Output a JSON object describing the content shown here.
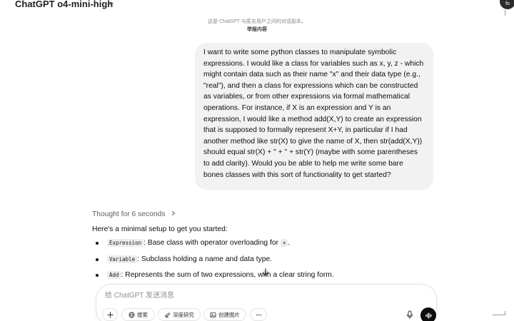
{
  "header": {
    "model_title": "ChatGPT o4-mini-high",
    "avatar_label": "fo"
  },
  "shared_note": {
    "line1": "这是 ChatGPT 与匿名用户之间的对话副本。",
    "line2": "举报内容"
  },
  "conversation": {
    "user_message": "I want to write some python classes to manipulate symbolic expressions.  I would like a class for variables such as x, y, z - which might contain data such as their name \"x\" and their data type (e.g., \"real\"), and then a class for expressions which can be constructed as variables, or from other expressions via formal mathematical operations.  For instance, if X is an expression and Y is an expression, I would like a method add(X,Y) to create an expression that is supposed to formally represent X+Y, in particular if I had another method like str(X) to give the name of X, then str(add(X,Y)) should equal str(X) + \" + \" + str(Y) (maybe with some parentheses to add clarity).  Would you be able to help me write some bare bones classes with this sort of functionality to get started?",
    "thought_label": "Thought for 6 seconds",
    "assistant_intro": "Here's a minimal setup to get you started:",
    "bullets": [
      {
        "code": "Expression",
        "text": ": Base class with operator overloading for ",
        "code2": "+",
        "text2": "."
      },
      {
        "code": "Variable",
        "text": ": Subclass holding a name and data type."
      },
      {
        "code": "Add",
        "text": ": Represents the sum of two expressions, with a clear string form."
      }
    ]
  },
  "composer": {
    "placeholder": "给 ChatGPT 发送消息",
    "tools": [
      {
        "name": "search",
        "label": "搜索"
      },
      {
        "name": "deep-research",
        "label": "深度研究"
      },
      {
        "name": "create-image",
        "label": "创建图片"
      }
    ]
  }
}
